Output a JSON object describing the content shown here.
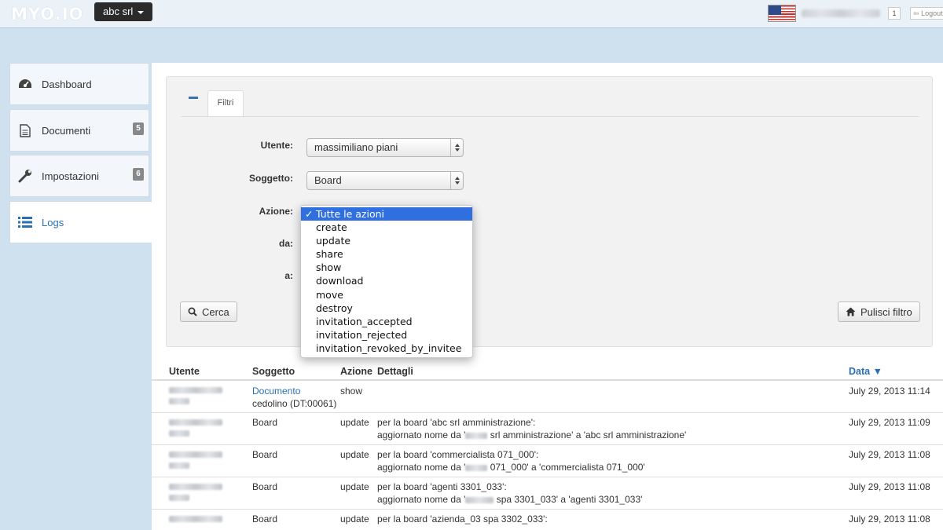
{
  "header": {
    "logo": "MYO.IO",
    "company": "abc srl",
    "notifications": "1",
    "logout": "Logout"
  },
  "sidebar": {
    "items": [
      {
        "label": "Dashboard",
        "icon": "dashboard-icon"
      },
      {
        "label": "Documenti",
        "icon": "document-icon",
        "badge": "5"
      },
      {
        "label": "Impostazioni",
        "icon": "wrench-icon",
        "badge": "6"
      },
      {
        "label": "Logs",
        "icon": "list-icon",
        "active": true
      }
    ]
  },
  "filters": {
    "tab_label": "Filtri",
    "utente_label": "Utente:",
    "utente_value": "massimiliano piani",
    "soggetto_label": "Soggetto:",
    "soggetto_value": "Board",
    "azione_label": "Azione:",
    "da_label": "da:",
    "a_label": "a:",
    "search_button": "Cerca",
    "clear_button": "Pulisci filtro"
  },
  "azione_dropdown": {
    "selected": "Tutte le azioni",
    "options": [
      "Tutte le azioni",
      "create",
      "update",
      "share",
      "show",
      "download",
      "move",
      "destroy",
      "invitation_accepted",
      "invitation_rejected",
      "invitation_revoked_by_invitee"
    ]
  },
  "table": {
    "headers": {
      "utente": "Utente",
      "soggetto": "Soggetto",
      "azione": "Azione",
      "dettagli": "Dettagli",
      "data": "Data ▼"
    },
    "rows": [
      {
        "soggetto_link": "Documento",
        "soggetto_sub": "cedolino (DT:00061)",
        "azione": "show",
        "dettagli_1": "",
        "dettagli_2_pre": "",
        "dettagli_2_post": "",
        "data": "July 29, 2013 11:14"
      },
      {
        "soggetto": "Board",
        "azione": "update",
        "dettagli_1": "per la board 'abc srl amministrazione':",
        "dettagli_2_pre": "aggiornato nome da '",
        "dettagli_2_post": " srl amministrazione' a 'abc srl amministrazione'",
        "data": "July 29, 2013 11:09"
      },
      {
        "soggetto": "Board",
        "azione": "update",
        "dettagli_1": "per la board 'commercialista 071_000':",
        "dettagli_2_pre": "aggiornato nome da '",
        "dettagli_2_post": " 071_000' a 'commercialista 071_000'",
        "data": "July 29, 2013 11:08"
      },
      {
        "soggetto": "Board",
        "azione": "update",
        "dettagli_1": "per la board 'agenti 3301_033':",
        "dettagli_2_pre": "aggiornato nome da '",
        "dettagli_2_post": " spa 3301_033' a 'agenti 3301_033'",
        "data": "July 29, 2013 11:08"
      },
      {
        "soggetto": "Board",
        "azione": "update",
        "dettagli_1": "per la board 'azienda_03 spa 3302_033':",
        "dettagli_2_pre": "",
        "dettagli_2_post": "",
        "data": "July 29, 2013 11:08"
      }
    ]
  }
}
